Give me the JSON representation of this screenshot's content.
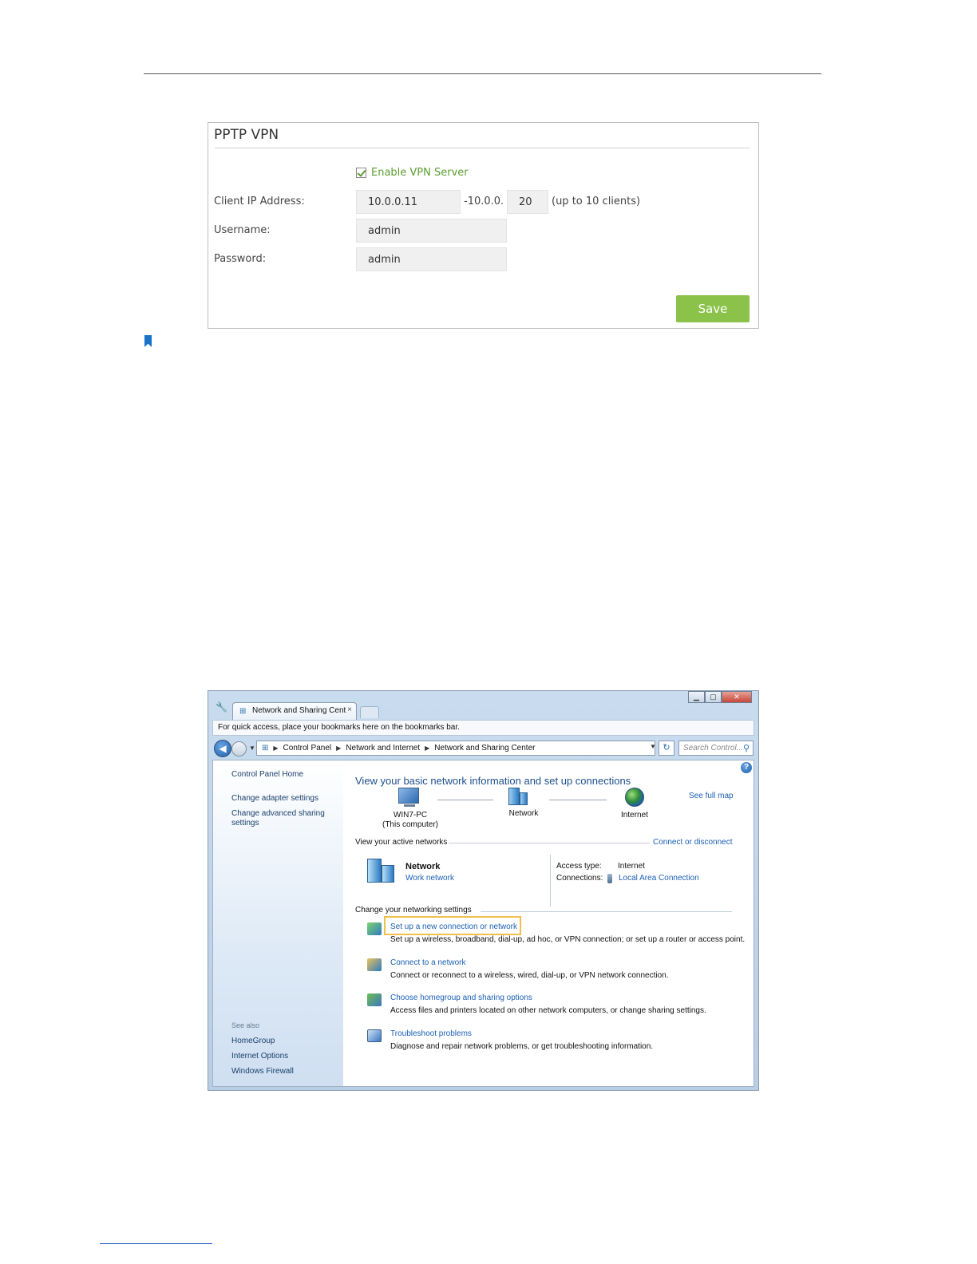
{
  "vpn": {
    "title": "PPTP VPN",
    "enable_label": "Enable VPN Server",
    "client_ip_label": "Client IP Address:",
    "client_ip_start": "10.0.0.11",
    "client_ip_sep": "-10.0.0.",
    "client_ip_end": "20",
    "client_ip_hint": "(up to 10 clients)",
    "username_label": "Username:",
    "username_value": "admin",
    "password_label": "Password:",
    "password_value": "admin",
    "save_label": "Save",
    "accent_color": "#8bc34a"
  },
  "window": {
    "tab_title": "Network and Sharing Cent",
    "tab_close": "×",
    "bookmarks_text": "For quick access, place your bookmarks here on the bookmarks bar.",
    "breadcrumb": [
      "Control Panel",
      "Network and Internet",
      "Network and Sharing Center"
    ],
    "search_placeholder": "Search Control...",
    "left_pane": {
      "home": "Control Panel Home",
      "links": [
        "Change adapter settings",
        "Change advanced sharing settings"
      ],
      "see_also_label": "See also",
      "see_also": [
        "HomeGroup",
        "Internet Options",
        "Windows Firewall"
      ]
    },
    "content": {
      "title": "View your basic network information and set up connections",
      "see_full_map": "See full map",
      "map": {
        "computer_name": "WIN7-PC",
        "computer_sub": "(This computer)",
        "network": "Network",
        "internet": "Internet"
      },
      "active_networks_label": "View your active networks",
      "connect_disconnect": "Connect or disconnect",
      "active_network": {
        "name": "Network",
        "type": "Work network",
        "access_type_label": "Access type:",
        "access_type_value": "Internet",
        "connections_label": "Connections:",
        "connections_value": "Local Area Connection"
      },
      "change_settings_label": "Change your networking settings",
      "tasks": [
        {
          "link": "Set up a new connection or network",
          "desc": "Set up a wireless, broadband, dial-up, ad hoc, or VPN connection; or set up a router or access point."
        },
        {
          "link": "Connect to a network",
          "desc": "Connect or reconnect to a wireless, wired, dial-up, or VPN network connection."
        },
        {
          "link": "Choose homegroup and sharing options",
          "desc": "Access files and printers located on other network computers, or change sharing settings."
        },
        {
          "link": "Troubleshoot problems",
          "desc": "Diagnose and repair network problems, or get troubleshooting information."
        }
      ]
    }
  }
}
